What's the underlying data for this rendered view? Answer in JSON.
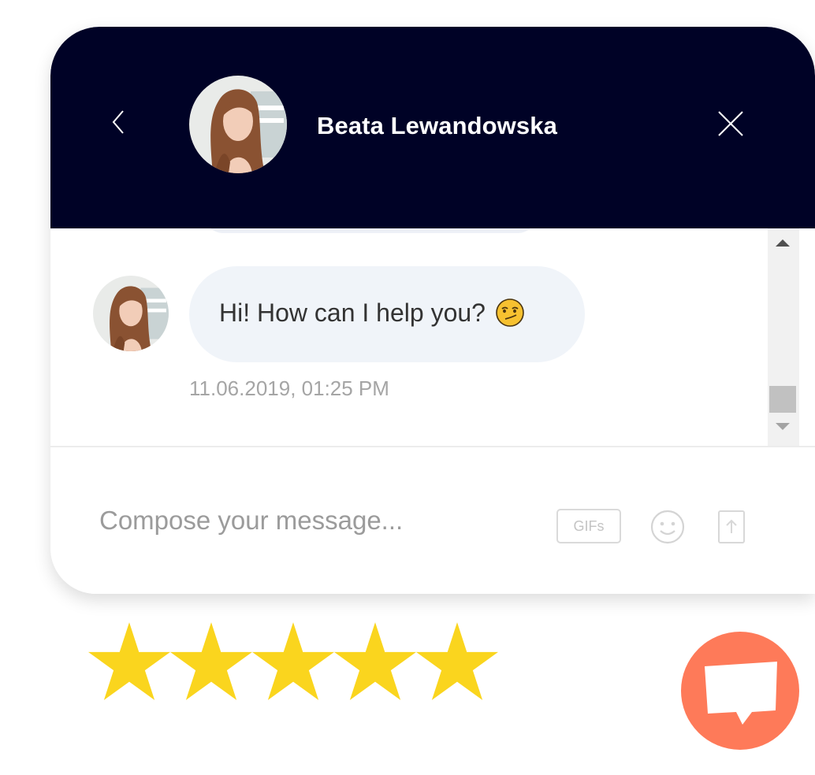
{
  "header": {
    "agent_name": "Beata Lewandowska",
    "back_icon": "chevron-left-icon",
    "close_icon": "close-icon",
    "background_color": "#000226"
  },
  "messages": {
    "items": [
      {
        "text": "Hi! How can I help you?",
        "emoji": "smirking-face-emoji",
        "timestamp": "11.06.2019, 01:25 PM"
      }
    ]
  },
  "composer": {
    "placeholder": "Compose your message...",
    "value": "",
    "gifs_label": "GIFs",
    "emoji_icon": "smiley-icon",
    "upload_icon": "upload-icon"
  },
  "rating": {
    "value": 5,
    "max": 5,
    "color": "#fad51e"
  },
  "launcher": {
    "icon": "chat-bubble-icon",
    "color": "#fe7a59"
  }
}
